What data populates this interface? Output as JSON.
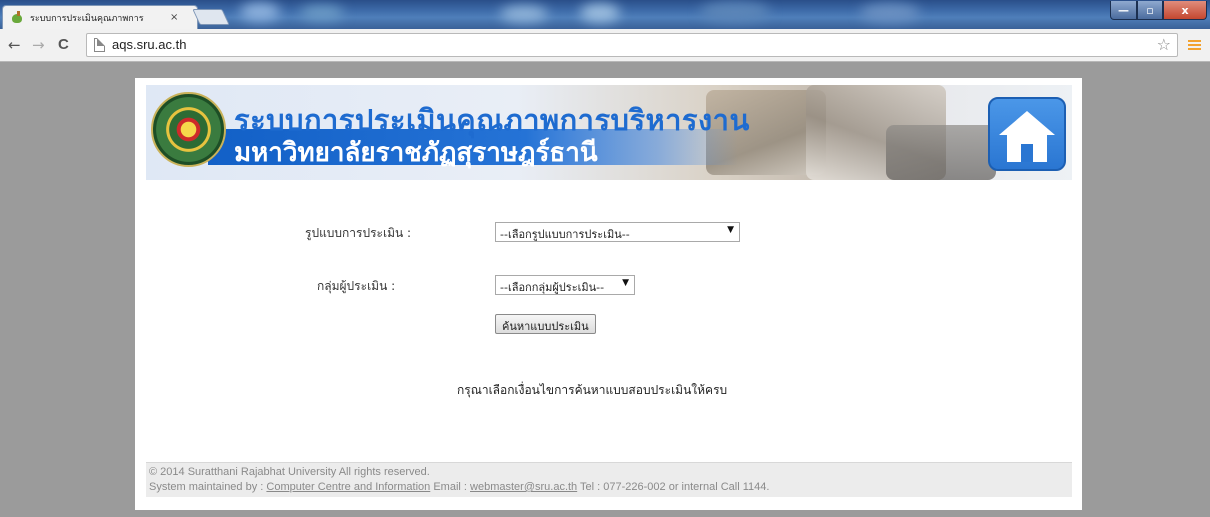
{
  "browser": {
    "tab_title": "ระบบการประเมินคุณภาพการ",
    "tab_close": "×",
    "url": "aqs.sru.ac.th",
    "back_icon": "←",
    "forward_icon": "→",
    "reload_icon": "C",
    "star_icon": "☆",
    "window_minimize": "—",
    "window_maximize": "▫",
    "window_close": "x"
  },
  "banner": {
    "title_line1": "ระบบการประเมินคุณภาพการบริหารงาน",
    "title_line2": "มหาวิทยาลัยราชภัฏสุราษฎร์ธานี"
  },
  "form": {
    "evaluation_type_label": "รูปแบบการประเมิน :",
    "evaluation_type_value": "--เลือกรูปแบบการประเมิน--",
    "evaluator_group_label": "กลุ่มผู้ประเมิน :",
    "evaluator_group_value": "--เลือกกลุ่มผู้ประเมิน--",
    "search_button": "ค้นหาแบบประเมิน",
    "notice": "กรุณาเลือกเงื่อนไขการค้นหาแบบสอบประเมินให้ครบ"
  },
  "footer": {
    "copyright": "© 2014 Suratthani Rajabhat University All rights reserved.",
    "maintained_prefix": "System maintained by :",
    "maintainer_link": "Computer Centre and Information",
    "email_prefix": "Email :",
    "email_link": "webmaster@sru.ac.th",
    "contact": "Tel : 077-226-002 or internal Call 1144."
  }
}
